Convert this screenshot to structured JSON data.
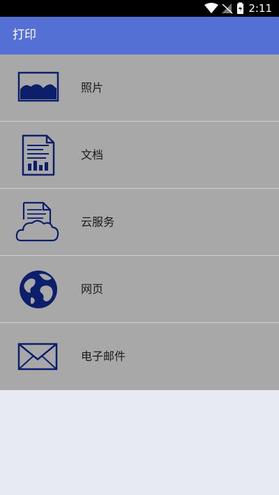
{
  "status_bar": {
    "time": "2:11"
  },
  "app_bar": {
    "title": "打印"
  },
  "menu": {
    "items": [
      {
        "label": "照片",
        "icon": "photo-icon"
      },
      {
        "label": "文档",
        "icon": "document-icon"
      },
      {
        "label": "云服务",
        "icon": "cloud-document-icon"
      },
      {
        "label": "网页",
        "icon": "globe-icon"
      },
      {
        "label": "电子邮件",
        "icon": "envelope-icon"
      }
    ]
  },
  "colors": {
    "app_bar": "#5570d5",
    "icon_navy": "#0d1e6b",
    "menu_background": "#a8a8a8",
    "page_background": "#e8eaf3"
  }
}
